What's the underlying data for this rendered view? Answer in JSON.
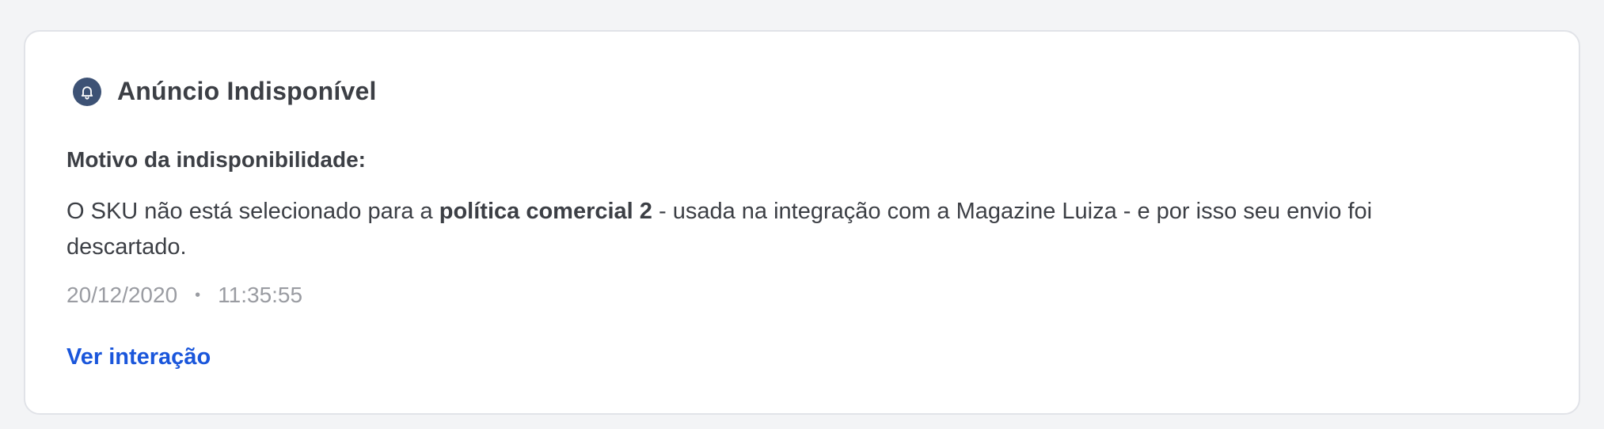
{
  "colors": {
    "page_bg": "#f3f4f6",
    "card_bg": "#ffffff",
    "icon_bg": "#3d5275",
    "text": "#3c3f45",
    "muted": "#9a9ca2",
    "link": "#1a56db"
  },
  "notification": {
    "icon": "bell-icon",
    "title": "Anúncio Indisponível",
    "reason_label": "Motivo da indisponibilidade:",
    "message": {
      "before": "O SKU não está selecionado para a ",
      "bold": "política comercial 2",
      "after": " - usada na integração com a Magazine Luiza - e por isso seu envio foi descartado."
    },
    "date": "20/12/2020",
    "separator": "•",
    "time": "11:35:55",
    "link_label": "Ver interação"
  }
}
